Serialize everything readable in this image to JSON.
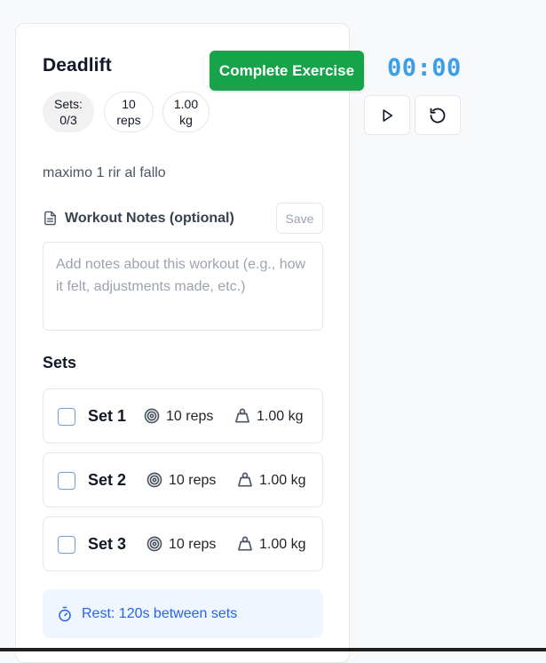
{
  "exercise": {
    "name": "Deadlift",
    "complete_label": "Complete Exercise",
    "badges": {
      "sets_label": "Sets:",
      "sets_value": "0/3",
      "reps_value": "10",
      "reps_unit": "reps",
      "weight_value": "1.00",
      "weight_unit": "kg"
    },
    "description": "maximo 1 rir al fallo"
  },
  "timer": {
    "display": "00:00",
    "play_icon": "play-icon",
    "reset_icon": "reset-icon"
  },
  "notes": {
    "label": "Workout Notes (optional)",
    "icon": "document-icon",
    "save_label": "Save",
    "placeholder": "Add notes about this workout (e.g., how it felt, adjustments made, etc.)",
    "value": ""
  },
  "sets": {
    "title": "Sets",
    "items": [
      {
        "label": "Set 1",
        "reps": "10 reps",
        "weight": "1.00 kg",
        "checked": false
      },
      {
        "label": "Set 2",
        "reps": "10 reps",
        "weight": "1.00 kg",
        "checked": false
      },
      {
        "label": "Set 3",
        "reps": "10 reps",
        "weight": "1.00 kg",
        "checked": false
      }
    ],
    "reps_icon": "target-icon",
    "weight_icon": "weight-icon"
  },
  "rest": {
    "label": "Rest: 120s between sets",
    "icon": "stopwatch-icon"
  },
  "colors": {
    "complete_button": "#16a34a",
    "timer": "#3b9ee8",
    "rest_text": "#2563eb",
    "rest_background": "#eff6ff"
  }
}
